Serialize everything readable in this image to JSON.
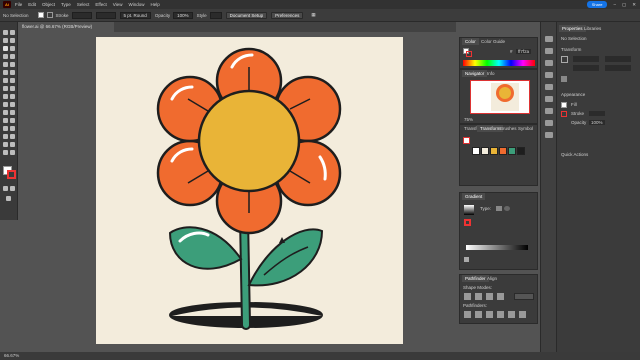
{
  "menubar": {
    "logo": "Ai",
    "items": [
      "File",
      "Edit",
      "Object",
      "Type",
      "Select",
      "Effect",
      "View",
      "Window",
      "Help"
    ],
    "share_label": "Share"
  },
  "controlbar": {
    "selection": "No Selection",
    "stroke_label": "Stroke",
    "brush": "5 pt. Round",
    "opacity_label": "Opacity",
    "opacity": "100%",
    "style_label": "Style",
    "doc_setup": "Document Setup",
    "preferences": "Preferences"
  },
  "document": {
    "tab_title": "flower.ai @ 66.67% (RGB/Preview)"
  },
  "panels": {
    "color_tab": "Color",
    "color_guide_tab": "Color Guide",
    "hex_label": "#",
    "hex_value": "ff7f2a",
    "navigator_tab": "Navigator",
    "info_tab": "Info",
    "zoom": "75%",
    "swatches_tabs": [
      "Transfo",
      "Transform",
      "Brushes",
      "Symbol"
    ],
    "gradient_tab": "Gradient",
    "gradient_type": "Type:",
    "pathfinder_tabs": [
      "Pathfinder",
      "Align"
    ],
    "shape_modes": "Shape Modes:",
    "pathfinders": "Pathfinders:"
  },
  "properties": {
    "tabs": [
      "Properties",
      "Libraries"
    ],
    "no_selection": "No Selection",
    "transform": "Transform",
    "appearance": "Appearance",
    "fill": "Fill",
    "stroke": "Stroke",
    "opacity": "Opacity",
    "opacity_value": "100%",
    "quick_actions": "Quick Actions"
  },
  "swatch_colors": [
    "#ffffff",
    "#f3ecdc",
    "#e9b437",
    "#f06b2f",
    "#3c9e7a",
    "#1e1e1e"
  ],
  "status": {
    "zoom": "66.67%"
  }
}
